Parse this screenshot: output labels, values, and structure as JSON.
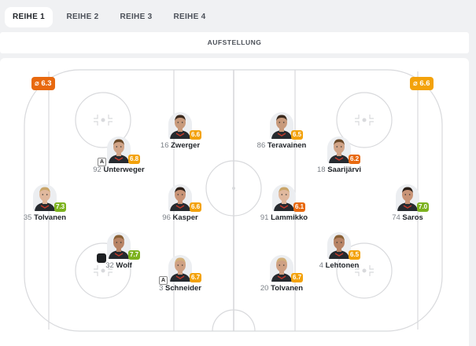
{
  "tabs": [
    "REIHE 1",
    "REIHE 2",
    "REIHE 3",
    "REIHE 4"
  ],
  "active_tab": 0,
  "subheader": "AUFSTELLUNG",
  "team_ratings": {
    "left": {
      "value": "6.3",
      "icon": "avg-icon",
      "color": "#e8690f"
    },
    "right": {
      "value": "6.6",
      "icon": "avg-icon",
      "color": "#f3a20b"
    }
  },
  "colors": {
    "rating_green": "#7cb21e",
    "rating_yellow": "#f3a20b",
    "rating_orange": "#e8690f",
    "rink_line": "#d8d9dc"
  },
  "players": [
    {
      "number": "16",
      "name": "Zwerger",
      "rating": "6.6",
      "tone": "yellow",
      "badge": ""
    },
    {
      "number": "92",
      "name": "Unterweger",
      "rating": "6.8",
      "tone": "yellow",
      "badge": "A"
    },
    {
      "number": "35",
      "name": "Tolvanen",
      "rating": "7.3",
      "tone": "green",
      "badge": ""
    },
    {
      "number": "96",
      "name": "Kasper",
      "rating": "6.6",
      "tone": "yellow",
      "badge": ""
    },
    {
      "number": "32",
      "name": "Wolf",
      "rating": "7.7",
      "tone": "green",
      "badge": "puck"
    },
    {
      "number": "3",
      "name": "Schneider",
      "rating": "6.7",
      "tone": "yellow",
      "badge": "A"
    },
    {
      "number": "86",
      "name": "Teravainen",
      "rating": "6.5",
      "tone": "yellow",
      "badge": ""
    },
    {
      "number": "18",
      "name": "Saarijärvi",
      "rating": "6.2",
      "tone": "orange",
      "badge": ""
    },
    {
      "number": "91",
      "name": "Lammikko",
      "rating": "6.1",
      "tone": "orange",
      "badge": ""
    },
    {
      "number": "74",
      "name": "Saros",
      "rating": "7.0",
      "tone": "green",
      "badge": ""
    },
    {
      "number": "4",
      "name": "Lehtonen",
      "rating": "6.5",
      "tone": "yellow",
      "badge": ""
    },
    {
      "number": "20",
      "name": "Tolvanen",
      "rating": "6.7",
      "tone": "yellow",
      "badge": ""
    }
  ]
}
